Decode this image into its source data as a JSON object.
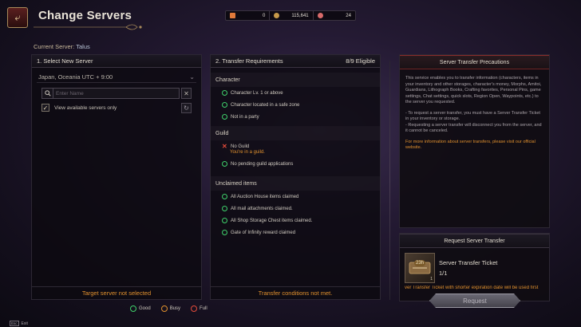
{
  "header": {
    "title": "Change Servers",
    "back_icon": "back-arrow-icon",
    "currency": [
      {
        "icon": "ticket-icon",
        "color": "#e07a3a",
        "value": "0"
      },
      {
        "icon": "silver-coin-icon",
        "color": "#c79a4a",
        "value": "115,641"
      },
      {
        "icon": "crystal-icon",
        "color": "#d86a6a",
        "value": "24"
      }
    ]
  },
  "current_server": {
    "label": "Current Server:",
    "value": "Talus"
  },
  "select_panel": {
    "title": "1. Select New Server",
    "region": "Japan, Oceania UTC + 9:00",
    "search_placeholder": "Enter Name",
    "available_only_label": "View available servers only",
    "available_only_checked": true,
    "footer": "Target server not selected"
  },
  "requirements_panel": {
    "title": "2. Transfer Requirements",
    "eligible": "8/9 Eligible",
    "sections": [
      {
        "title": "Character",
        "items": [
          {
            "text": "Character Lv. 1 or above",
            "ok": true
          },
          {
            "text": "Character located in a safe zone",
            "ok": true
          },
          {
            "text": "Not in a party",
            "ok": true
          }
        ]
      },
      {
        "title": "Guild",
        "items": [
          {
            "text": "No Guild",
            "ok": false,
            "note": "You're in a guild."
          },
          {
            "text": "No pending guild applications",
            "ok": true
          }
        ]
      },
      {
        "title": "Unclaimed items",
        "items": [
          {
            "text": "All Auction House items claimed",
            "ok": true
          },
          {
            "text": "All mail attachments claimed.",
            "ok": true
          },
          {
            "text": "All Shop Storage Chest items claimed.",
            "ok": true
          },
          {
            "text": "Gate of Infinity reward claimed",
            "ok": true
          }
        ]
      }
    ],
    "footer": "Transfer conditions not met."
  },
  "precautions": {
    "title": "Server Transfer Precautions",
    "paragraphs": [
      "This service enables you to transfer information (characters, items in your inventory and other storages, character's money, Morphs, Amitoi, Guardians, Lithograph Books, Crafting favorites, Personal Pins, game settings, Chat settings, quick slots, Region Open, Waypoints, etc.) to the server you requested.",
      "- To request a server transfer, you must have a Server Transfer Ticket in your inventory or storage.\n- Requesting a server transfer will disconnect you from the server, and it cannot be canceled."
    ],
    "warning": "For more information about server transfers, please visit our official website."
  },
  "request_panel": {
    "title": "Request Server Transfer",
    "ticket_name": "Server Transfer Ticket",
    "ticket_count": "1/1",
    "ticket_badge": "23h",
    "ticket_qty": "1",
    "note": "ver Transfer Ticket with shorter expiration date will be used first",
    "button": "Request"
  },
  "legend": [
    {
      "label": "Good",
      "color": "#3fd06b"
    },
    {
      "label": "Busy",
      "color": "#e0902e"
    },
    {
      "label": "Full",
      "color": "#e24b3a"
    }
  ],
  "exit_hint": {
    "key": "Esc",
    "label": "Exit"
  }
}
